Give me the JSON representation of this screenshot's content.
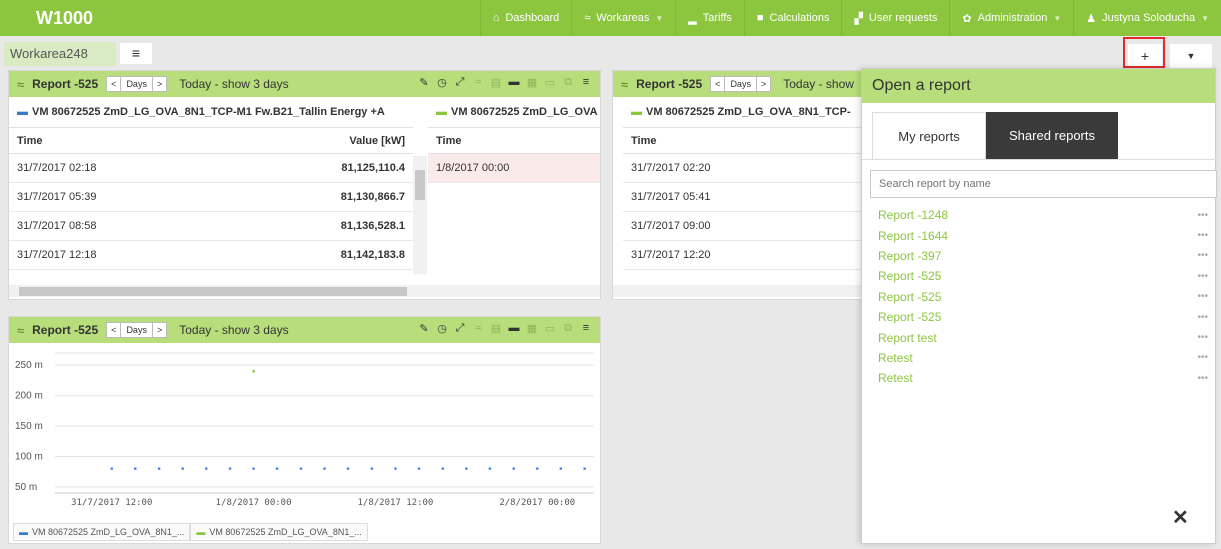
{
  "app": {
    "brand": "W1000"
  },
  "nav": [
    {
      "icon": "home-icon",
      "glyph": "⌂",
      "label": "Dashboard",
      "dropdown": false
    },
    {
      "icon": "workareas-icon",
      "glyph": "≈",
      "label": "Workareas",
      "dropdown": true
    },
    {
      "icon": "tariffs-icon",
      "glyph": "▂",
      "label": "Tariffs",
      "dropdown": false
    },
    {
      "icon": "calculations-icon",
      "glyph": "■",
      "label": "Calculations",
      "dropdown": false
    },
    {
      "icon": "user-requests-icon",
      "glyph": "▞",
      "label": "User requests",
      "dropdown": false
    },
    {
      "icon": "gear-icon",
      "glyph": "✿",
      "label": "Administration",
      "dropdown": true
    },
    {
      "icon": "user-icon",
      "glyph": "♟",
      "label": "Justyna Soloducha",
      "dropdown": true
    }
  ],
  "workarea": {
    "tab_label": "Workarea248",
    "menu_glyph": "≡",
    "plus_glyph": "+",
    "down_glyph": "▼"
  },
  "panel1": {
    "title": "Report -525",
    "prev": "<",
    "period": "Days",
    "next": ">",
    "range": "Today - show  3  days",
    "table1": {
      "source": "VM 80672525 ZmD_LG_OVA_8N1_TCP-M1 Fw.B21_Tallin Energy +A",
      "col_time": "Time",
      "col_value": "Value [kW]",
      "rows": [
        {
          "time": "31/7/2017 02:18",
          "value": "81,125,110.4"
        },
        {
          "time": "31/7/2017 05:39",
          "value": "81,130,866.7"
        },
        {
          "time": "31/7/2017 08:58",
          "value": "81,136,528.1"
        },
        {
          "time": "31/7/2017 12:18",
          "value": "81,142,183.8"
        }
      ]
    },
    "table2": {
      "source": "VM 80672525 ZmD_LG_OVA",
      "col_time": "Time",
      "rows": [
        {
          "time": "1/8/2017 00:00"
        }
      ]
    }
  },
  "panel2": {
    "title": "Report -525",
    "prev": "<",
    "period": "Days",
    "next": ">",
    "range": "Today - show",
    "table": {
      "source": "VM 80672525 ZmD_LG_OVA_8N1_TCP-",
      "col_time": "Time",
      "rows": [
        {
          "time": "31/7/2017 02:20"
        },
        {
          "time": "31/7/2017 05:41"
        },
        {
          "time": "31/7/2017 09:00"
        },
        {
          "time": "31/7/2017 12:20"
        }
      ]
    }
  },
  "panel3": {
    "title": "Report -525",
    "prev": "<",
    "period": "Days",
    "next": ">",
    "range": "Today - show  3  days",
    "legend": [
      "VM 80672525 ZmD_LG_OVA_8N1_...",
      "VM 80672525 ZmD_LG_OVA_8N1_..."
    ]
  },
  "chart_data": {
    "type": "scatter",
    "title": "",
    "xlabel": "",
    "ylabel": "",
    "y_ticks": [
      "250 m",
      "200 m",
      "150 m",
      "100 m",
      "50 m"
    ],
    "y_tick_values": [
      250,
      200,
      150,
      100,
      50
    ],
    "x_ticks": [
      "31/7/2017 12:00",
      "1/8/2017 00:00",
      "1/8/2017 12:00",
      "2/8/2017 00:00"
    ],
    "ylim": [
      40,
      270
    ],
    "grid": true,
    "series": [
      {
        "color": "#4a86e8",
        "x": [
          0.0,
          0.083,
          0.167,
          0.25,
          0.333,
          0.417,
          0.5,
          0.583,
          0.667,
          0.75,
          0.833,
          0.917,
          1.0,
          1.083,
          1.167,
          1.25,
          1.333,
          1.417,
          1.5,
          1.583,
          1.667
        ],
        "y": [
          80,
          80,
          80,
          80,
          80,
          80,
          80,
          80,
          80,
          80,
          80,
          80,
          80,
          80,
          80,
          80,
          80,
          80,
          80,
          80,
          80
        ]
      },
      {
        "color": "#8cc63f",
        "x": [
          0.5
        ],
        "y": [
          240
        ]
      }
    ]
  },
  "open_report": {
    "title": "Open a report",
    "tab_mine": "My reports",
    "tab_shared": "Shared reports",
    "search_placeholder": "Search report by name",
    "items": [
      "Report -1248",
      "Report -1644",
      "Report -397",
      "Report -525",
      "Report -525",
      "Report -525",
      "Report test",
      "Retest",
      "Retest"
    ],
    "close_glyph": "✕"
  }
}
